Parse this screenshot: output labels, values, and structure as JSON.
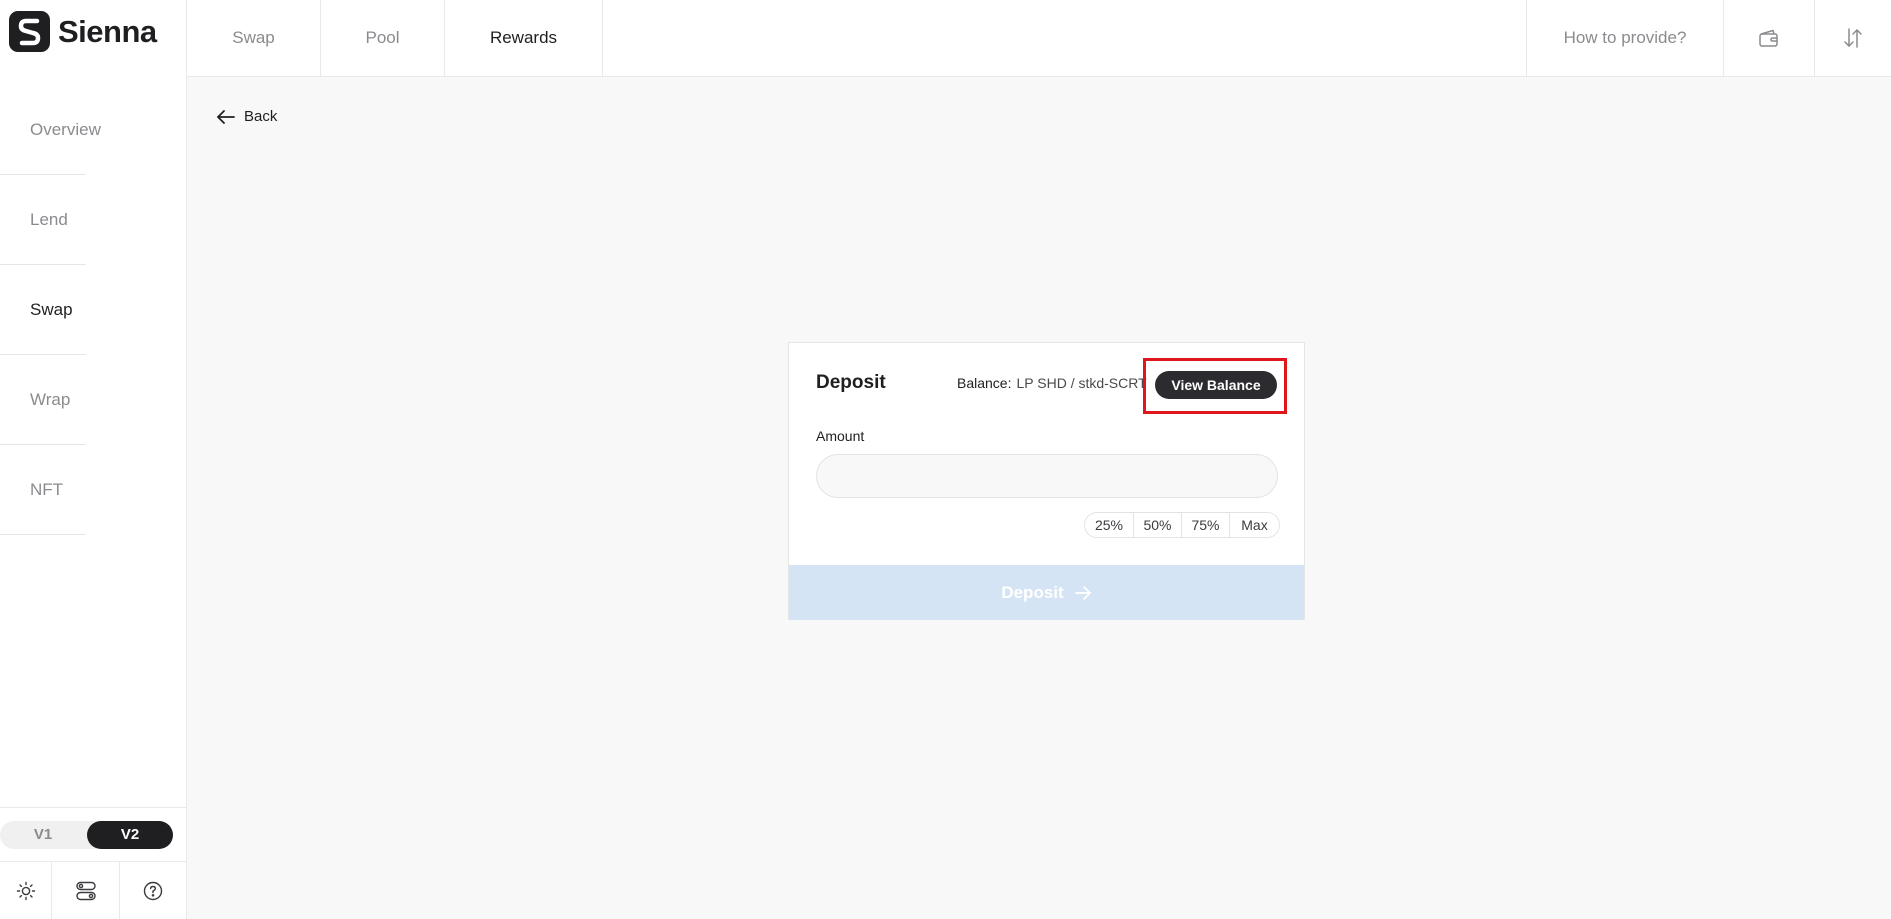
{
  "brand": {
    "name": "Sienna"
  },
  "sidebar": {
    "items": [
      {
        "label": "Overview"
      },
      {
        "label": "Lend"
      },
      {
        "label": "Swap"
      },
      {
        "label": "Wrap"
      },
      {
        "label": "NFT"
      }
    ],
    "active_item": "Swap",
    "version": {
      "v1": "V1",
      "v2": "V2",
      "selected": "V2"
    },
    "bottom_icons": [
      "sun-icon",
      "toggle-settings-icon",
      "help-circle-icon"
    ]
  },
  "topbar": {
    "tabs": [
      {
        "label": "Swap"
      },
      {
        "label": "Pool"
      },
      {
        "label": "Rewards"
      }
    ],
    "active_tab": "Rewards",
    "how_to": "How to provide?",
    "icons": [
      "wallet-icon",
      "sort-arrows-icon"
    ]
  },
  "back": {
    "label": "Back",
    "icon": "arrow-left-icon"
  },
  "deposit_card": {
    "title": "Deposit",
    "balance_label": "Balance:",
    "balance_token": "LP SHD / stkd-SCRT",
    "view_balance": "View Balance",
    "amount_label": "Amount",
    "amount_value": "",
    "amount_placeholder": "",
    "percent_buttons": [
      "25%",
      "50%",
      "75%",
      "Max"
    ],
    "submit_label": "Deposit",
    "submit_icon": "arrow-right-icon"
  },
  "colors": {
    "primary_dark": "#1f1f22",
    "muted_text": "#8b8b8f",
    "background": "#f8f8f8",
    "disabled_button": "#d5e4f5",
    "highlight": "#e0161e"
  }
}
